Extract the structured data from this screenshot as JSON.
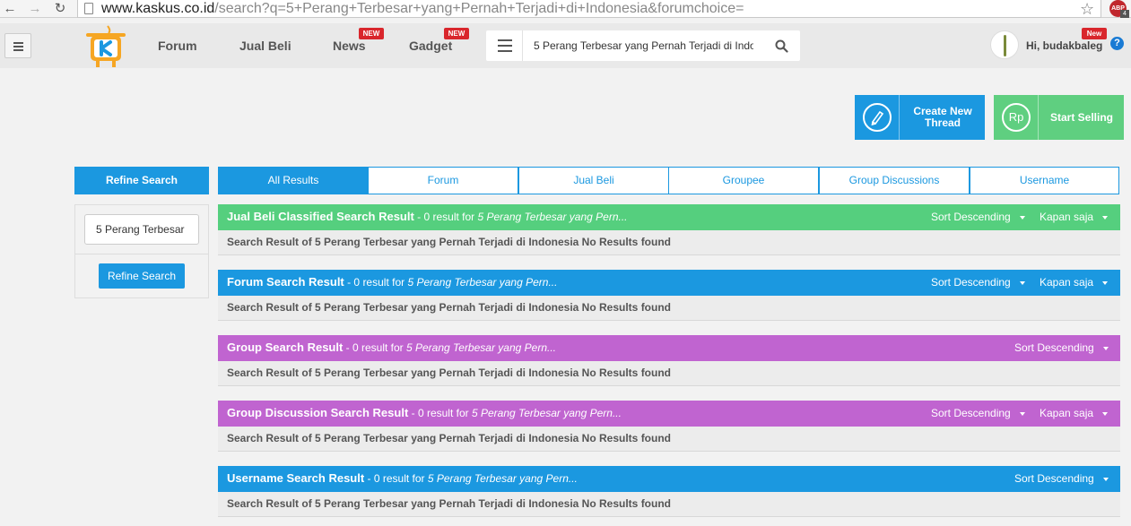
{
  "browser": {
    "url_host": "www.kaskus.co.id",
    "url_path": "/search?q=5+Perang+Terbesar+yang+Pernah+Terjadi+di+Indonesia&forumchoice=",
    "adblock_label": "ABP",
    "adblock_count": "4"
  },
  "header": {
    "nav": [
      {
        "label": "Forum",
        "badge": ""
      },
      {
        "label": "Jual Beli",
        "badge": ""
      },
      {
        "label": "News",
        "badge": "NEW"
      },
      {
        "label": "Gadget",
        "badge": "NEW"
      }
    ],
    "search_value": "5 Perang Terbesar yang Pernah Terjadi di Indo",
    "user_greeting": "Hi, budakbaleg",
    "user_badge": "New",
    "help_symbol": "?"
  },
  "actions": {
    "create_thread": {
      "label_line1": "Create New",
      "label_line2": "Thread",
      "color": "#1b98e0"
    },
    "start_selling": {
      "label": "Start Selling",
      "icon_text": "Rp",
      "color": "#5fcf80"
    }
  },
  "sidebar": {
    "title": "Refine Search",
    "input_value": "5 Perang Terbesar",
    "button_label": "Refine Search"
  },
  "tabs": [
    {
      "label": "All Results",
      "active": true
    },
    {
      "label": "Forum",
      "active": false
    },
    {
      "label": "Jual Beli",
      "active": false
    },
    {
      "label": "Groupee",
      "active": false
    },
    {
      "label": "Group Discussions",
      "active": false
    },
    {
      "label": "Username",
      "active": false
    }
  ],
  "results": [
    {
      "title": "Jual Beli Classified Search Result",
      "count": " - 0 result for ",
      "query": "5 Perang Terbesar yang Pern...",
      "sort": "Sort Descending",
      "time": "Kapan saja",
      "body": "Search Result of 5 Perang Terbesar yang Pernah Terjadi di Indonesia No Results found",
      "color": "#55cf7e"
    },
    {
      "title": "Forum Search Result",
      "count": " - 0 result for ",
      "query": "5 Perang Terbesar yang Pern...",
      "sort": "Sort Descending",
      "time": "Kapan saja",
      "body": "Search Result of 5 Perang Terbesar yang Pernah Terjadi di Indonesia No Results found",
      "color": "#1b98e0"
    },
    {
      "title": "Group Search Result",
      "count": " - 0 result for ",
      "query": "5 Perang Terbesar yang Pern...",
      "sort": "Sort Descending",
      "time": "",
      "body": "Search Result of 5 Perang Terbesar yang Pernah Terjadi di Indonesia No Results found",
      "color": "#c064d0"
    },
    {
      "title": "Group Discussion Search Result",
      "count": " - 0 result for ",
      "query": "5 Perang Terbesar yang Pern...",
      "sort": "Sort Descending",
      "time": "Kapan saja",
      "body": "Search Result of 5 Perang Terbesar yang Pernah Terjadi di Indonesia No Results found",
      "color": "#c064d0"
    },
    {
      "title": "Username Search Result",
      "count": " - 0 result for ",
      "query": "5 Perang Terbesar yang Pern...",
      "sort": "Sort Descending",
      "time": "",
      "body": "Search Result of 5 Perang Terbesar yang Pernah Terjadi di Indonesia No Results found",
      "color": "#1b98e0"
    }
  ]
}
